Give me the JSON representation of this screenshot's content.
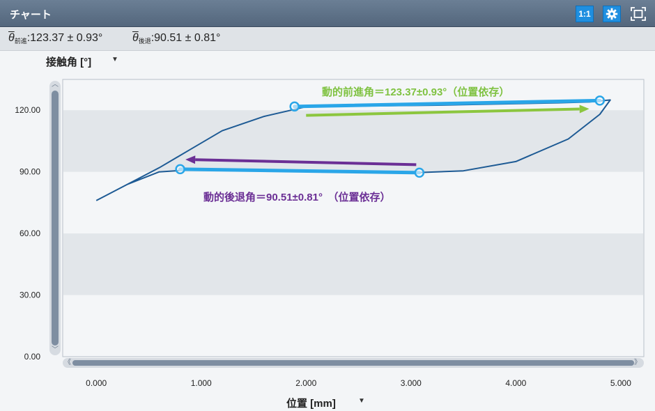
{
  "window": {
    "title": "チャート",
    "buttons": {
      "one_to_one": "1:1",
      "settings": "gear-icon",
      "fit": "fit-screen-icon"
    }
  },
  "stats": {
    "adv_sub": "前進",
    "adv_value": ":123.37  ± 0.93°",
    "rec_sub": "後退",
    "rec_value": ":90.51  ± 0.81°"
  },
  "axes": {
    "ylabel": "接触角 [°]",
    "xlabel": "位置 [mm]"
  },
  "chart_data": {
    "type": "line",
    "x_ticks": [
      "0.000",
      "1.000",
      "2.000",
      "3.000",
      "4.000",
      "5.000"
    ],
    "y_ticks": [
      "0.00",
      "30.00",
      "60.00",
      "90.00",
      "120.00"
    ],
    "xlim": [
      -0.32,
      5.22
    ],
    "ylim": [
      0,
      135
    ],
    "xlabel": "位置 [mm]",
    "ylabel": "接触角 [°]",
    "series": [
      {
        "x": [
          0.0,
          0.3,
          0.6,
          0.9,
          1.2,
          1.5,
          1.8,
          2.1,
          2.5,
          3.0,
          3.5,
          4.0,
          4.5,
          4.8,
          4.9,
          4.7,
          4.4,
          4.1,
          3.8,
          3.5,
          3.2,
          2.8,
          2.4,
          2.0,
          1.6,
          1.2,
          0.9,
          0.6,
          0.3,
          0.0
        ],
        "y": [
          76,
          84,
          90,
          91,
          91,
          90.6,
          90.3,
          90.1,
          90.0,
          89.5,
          90.5,
          95,
          106,
          118,
          125,
          124,
          123.6,
          123.3,
          123,
          122.7,
          122.4,
          122.2,
          122,
          121.7,
          117,
          110,
          101,
          92,
          84,
          76
        ],
        "color": "#1d5a94"
      }
    ],
    "fits": [
      {
        "x": [
          1.89,
          4.8
        ],
        "y": [
          121.8,
          124.7
        ],
        "color": "#2aa6e8"
      },
      {
        "x": [
          0.8,
          3.08
        ],
        "y": [
          91.3,
          89.6
        ],
        "color": "#2aa6e8"
      }
    ],
    "arrows": [
      {
        "x": [
          2.0,
          4.7
        ],
        "y": [
          117.5,
          120.7
        ],
        "color": "#8cc63f"
      },
      {
        "x": [
          3.05,
          0.85
        ],
        "y": [
          93.5,
          96.0
        ],
        "color": "#6b2f95"
      }
    ],
    "annotations": [
      {
        "text": "動的前進角＝123.37±0.93°（位置依存）",
        "color": "#7fc241"
      },
      {
        "text": "動的後退角＝90.51±0.81°　（位置依存）",
        "color": "#6b2f95"
      }
    ],
    "bands": [
      [
        30,
        60
      ],
      [
        90,
        120
      ]
    ],
    "grid": false
  }
}
